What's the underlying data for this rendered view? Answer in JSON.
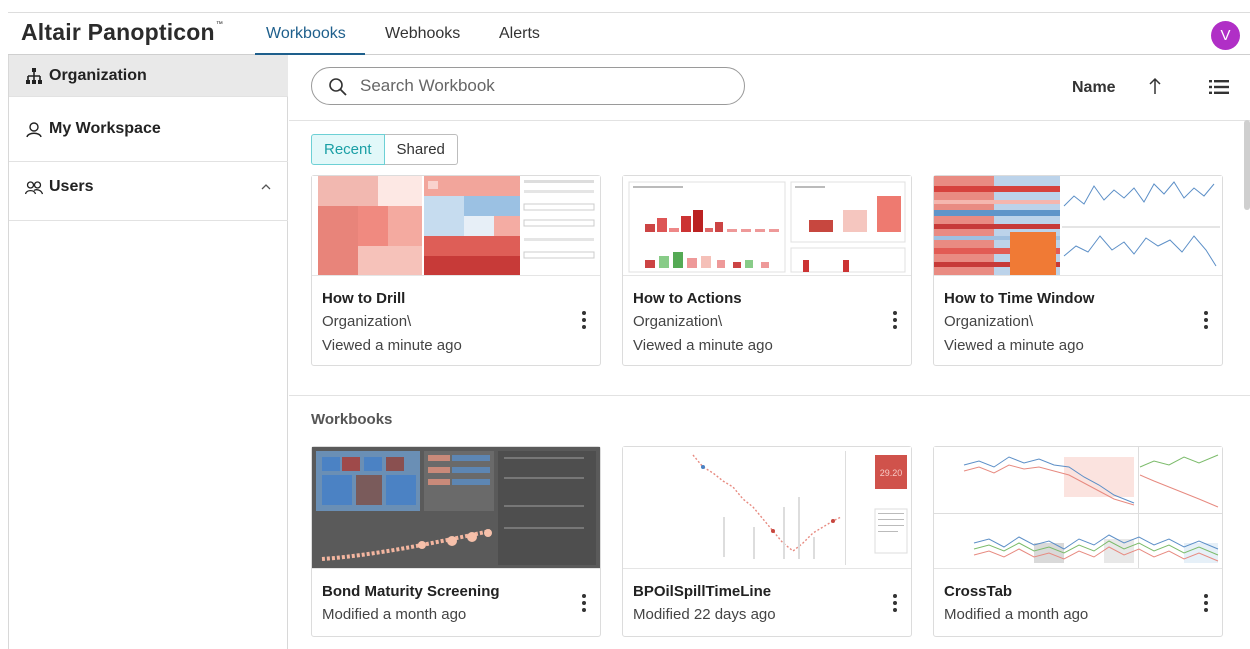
{
  "app": {
    "brand": "Altair Panopticon",
    "brand_tm": "™",
    "tabs": [
      {
        "label": "Workbooks",
        "active": true
      },
      {
        "label": "Webhooks",
        "active": false
      },
      {
        "label": "Alerts",
        "active": false
      }
    ],
    "avatar_initial": "V",
    "avatar_color": "#b02fc6",
    "accent_color": "#1e5f8c"
  },
  "sidebar": {
    "items": [
      {
        "label": "Organization",
        "icon": "org-tree-icon",
        "active": true
      },
      {
        "label": "My Workspace",
        "icon": "user-icon",
        "active": false
      },
      {
        "label": "Users",
        "icon": "users-icon",
        "active": false,
        "expanded": true
      }
    ]
  },
  "toolbar": {
    "search_placeholder": "Search Workbook",
    "search_value": "",
    "sort_label": "Name",
    "sort_direction": "ascending"
  },
  "filters": {
    "options": [
      "Recent",
      "Shared"
    ],
    "selected": "Recent"
  },
  "recent": {
    "cards": [
      {
        "title": "How to Drill",
        "path": "Organization\\",
        "status": "Viewed a minute ago",
        "thumb": "treemap"
      },
      {
        "title": "How to Actions",
        "path": "Organization\\",
        "status": "Viewed a minute ago",
        "thumb": "bars"
      },
      {
        "title": "How to Time Window",
        "path": "Organization\\",
        "status": "Viewed a minute ago",
        "thumb": "heatmap-lines"
      }
    ]
  },
  "workbooks": {
    "section_title": "Workbooks",
    "cards": [
      {
        "title": "Bond Maturity Screening",
        "status": "Modified a month ago",
        "thumb": "dark-dashboard",
        "badge": ""
      },
      {
        "title": "BPOilSpillTimeLine",
        "status": "Modified 22 days ago",
        "thumb": "timeline",
        "badge": "29.20"
      },
      {
        "title": "CrossTab",
        "status": "Modified a month ago",
        "thumb": "crosstab",
        "badge": ""
      }
    ]
  }
}
